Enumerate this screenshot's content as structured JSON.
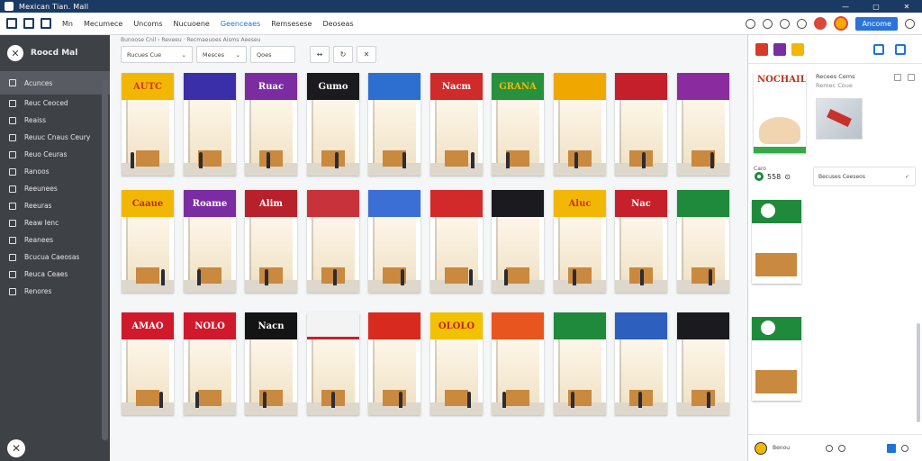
{
  "window": {
    "title": "Mexican Tian. Mall",
    "controls": [
      "—",
      "▢",
      "✕"
    ]
  },
  "toolbar": {
    "left_label": "Mn",
    "tabs": [
      "Mecumece",
      "Uncoms",
      "Nucuoene",
      "Geenceaes",
      "Remsesese",
      "Deoseas"
    ],
    "primary": "Ancome",
    "colors": {
      "accent": "#1e73d9",
      "title_bar": "#1b3a63"
    }
  },
  "sidebar": {
    "brand": "Roocd Mal",
    "items": [
      {
        "label": "Acunces",
        "icon": "home-icon"
      },
      {
        "label": "Reuc Ceoced",
        "icon": "square-icon"
      },
      {
        "label": "Reaiss",
        "icon": "square-icon"
      },
      {
        "label": "Reuuc Cnaus Ceury",
        "icon": "square-icon"
      },
      {
        "label": "Reuo Ceuras",
        "icon": "square-icon"
      },
      {
        "label": "Ranoos",
        "icon": "square-icon"
      },
      {
        "label": "Reeunees",
        "icon": "wrench-icon"
      },
      {
        "label": "Reeuras",
        "icon": "circle-icon"
      },
      {
        "label": "Reaw Ienc",
        "icon": "circle-icon"
      },
      {
        "label": "Reanees",
        "icon": "circle-icon"
      },
      {
        "label": "Bcucua Caeosas",
        "icon": "tag-icon"
      },
      {
        "label": "Reuca Ceaes",
        "icon": "check-icon"
      },
      {
        "label": "Renores",
        "icon": "bag-icon"
      }
    ]
  },
  "main": {
    "breadcrumb": "Bunoose Cnil › Reveeu  ·  Recmaeuoes Aisms Aeeseu",
    "filters": [
      "Rucues  Cue",
      "Mesces",
      "Qoes"
    ],
    "tools": [
      "↔",
      "↻",
      "✕"
    ],
    "tiles": [
      {
        "sign": "AUTC",
        "color": "#f2b705",
        "text_color": "#d03a1c"
      },
      {
        "sign": "",
        "color": "#3a2fa8"
      },
      {
        "sign": "Ruac",
        "color": "#7b2ca2"
      },
      {
        "sign": "Gumo",
        "color": "#1b1b1f"
      },
      {
        "sign": "",
        "color": "#2d6fd0"
      },
      {
        "sign": "Nacm",
        "color": "#d12a2a"
      },
      {
        "sign": "GRANA",
        "color": "#27913e",
        "text_color": "#f2b705"
      },
      {
        "sign": "",
        "color": "#f0a800"
      },
      {
        "sign": "",
        "color": "#c41f2a"
      },
      {
        "sign": "",
        "color": "#8a2ca0"
      },
      {
        "sign": "Caaue",
        "color": "#f2b705",
        "text_color": "#b5321c"
      },
      {
        "sign": "Roame",
        "color": "#7b2ca2"
      },
      {
        "sign": "Alim",
        "color": "#b8202c"
      },
      {
        "sign": "",
        "color": "#c8323a"
      },
      {
        "sign": "",
        "color": "#3b6fd6"
      },
      {
        "sign": "",
        "color": "#d22a2a"
      },
      {
        "sign": "",
        "color": "#1b1b1f"
      },
      {
        "sign": "Aluc",
        "color": "#f2b705",
        "text_color": "#c63a1c"
      },
      {
        "sign": "Nac",
        "color": "#c8202a"
      },
      {
        "sign": "",
        "color": "#1f8a3b"
      },
      {
        "sign": "AMAO",
        "color": "#d1192c"
      },
      {
        "sign": "NOLO",
        "color": "#d1192c"
      },
      {
        "sign": "Nacn",
        "color": "#141414"
      },
      {
        "sign": "",
        "color": "#f3f3f3"
      },
      {
        "sign": "",
        "color": "#d82a1e"
      },
      {
        "sign": "OLOLO",
        "color": "#f2c200",
        "text_color": "#c8202a"
      },
      {
        "sign": "",
        "color": "#e8551f"
      },
      {
        "sign": "",
        "color": "#1f8a3b"
      },
      {
        "sign": "",
        "color": "#2d5fbf"
      },
      {
        "sign": "",
        "color": "#1b1b1f"
      }
    ]
  },
  "right_panel": {
    "thumbs": [
      "#d63a2a",
      "#7a2ca2",
      "#f2b705"
    ],
    "preview_title": "NOCHAIL",
    "meta_title": "Recees Cems",
    "meta_sub": "Remec Coue",
    "count_label": "Caro",
    "count_value": "558",
    "detail_label": "Becuses Ceeseos",
    "footer_label": "Benou"
  }
}
